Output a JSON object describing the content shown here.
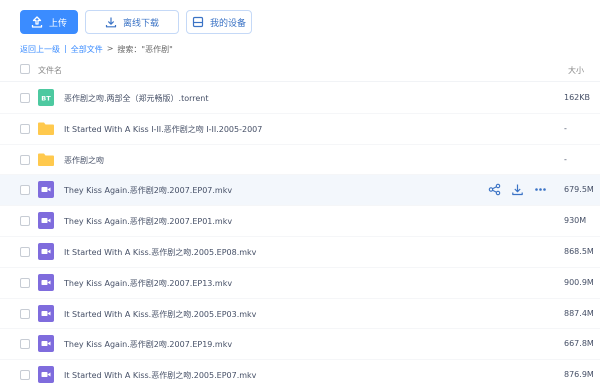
{
  "toolbar": {
    "upload_label": "上传",
    "offline_label": "离线下载",
    "device_label": "我的设备"
  },
  "breadcrumb": {
    "back": "返回上一级",
    "sep": "|",
    "all_files": "全部文件",
    "arrow": ">",
    "search": "搜索：\"恶作剧\""
  },
  "header": {
    "name": "文件名",
    "size": "大小"
  },
  "files": [
    {
      "type": "torrent",
      "name": "恶作剧之吻.两部全（郑元畅版）.torrent",
      "size": "162KB"
    },
    {
      "type": "folder",
      "name": "It Started With A Kiss I-II.恶作剧之吻 I-II.2005-2007",
      "size": "-"
    },
    {
      "type": "folder",
      "name": "恶作剧之吻",
      "size": "-"
    },
    {
      "type": "video",
      "name": "They Kiss Again.恶作剧2吻.2007.EP07.mkv",
      "size": "679.5M"
    },
    {
      "type": "video",
      "name": "They Kiss Again.恶作剧2吻.2007.EP01.mkv",
      "size": "930M"
    },
    {
      "type": "video",
      "name": "It Started With A Kiss.恶作剧之吻.2005.EP08.mkv",
      "size": "868.5M"
    },
    {
      "type": "video",
      "name": "They Kiss Again.恶作剧2吻.2007.EP13.mkv",
      "size": "900.9M"
    },
    {
      "type": "video",
      "name": "It Started With A Kiss.恶作剧之吻.2005.EP03.mkv",
      "size": "887.4M"
    },
    {
      "type": "video",
      "name": "They Kiss Again.恶作剧2吻.2007.EP19.mkv",
      "size": "667.8M"
    },
    {
      "type": "video",
      "name": "It Started With A Kiss.恶作剧之吻.2005.EP07.mkv",
      "size": "876.9M"
    }
  ],
  "torrent_badge": "BT",
  "colors": {
    "accent": "#3b8cff",
    "torrent": "#4dc9a0",
    "folder": "#ffc94d",
    "video": "#7f6cdd"
  }
}
